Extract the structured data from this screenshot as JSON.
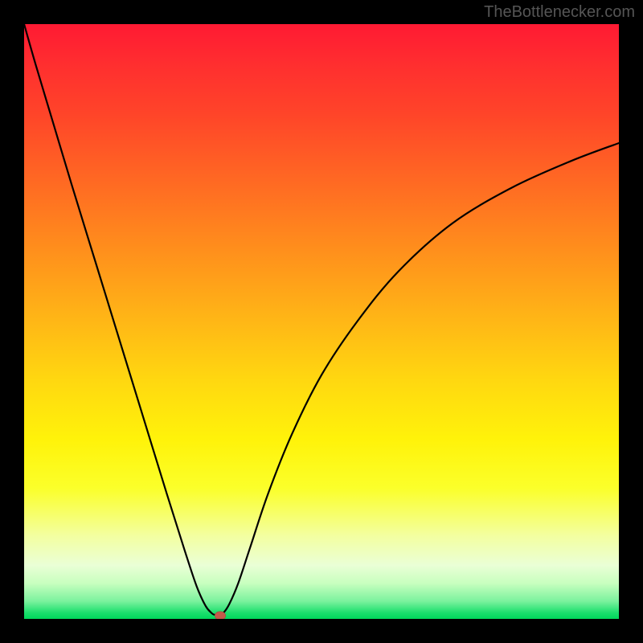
{
  "watermark": "TheBottlenecker.com",
  "chart_data": {
    "type": "line",
    "title": "",
    "xlabel": "",
    "ylabel": "",
    "xlim": [
      0,
      100
    ],
    "ylim": [
      0,
      100
    ],
    "x": [
      0,
      2,
      5,
      8,
      12,
      16,
      20,
      24,
      27,
      29,
      30.5,
      31.5,
      32,
      32.8,
      33.5,
      34.5,
      36,
      38,
      41,
      45,
      50,
      56,
      63,
      72,
      82,
      92,
      100
    ],
    "values": [
      100,
      93,
      83,
      73,
      60,
      47,
      34,
      21,
      11.5,
      5.5,
      2.2,
      1.0,
      0.7,
      0.7,
      1.0,
      2.5,
      6,
      12,
      21,
      31,
      41,
      50,
      58.5,
      66.5,
      72.5,
      77,
      80
    ],
    "marker": {
      "x": 33.0,
      "y": 0.5
    },
    "colors": {
      "line": "#000000",
      "marker": "#c25a4a",
      "gradient_top": "#ff1a33",
      "gradient_bottom": "#00d85b"
    }
  }
}
